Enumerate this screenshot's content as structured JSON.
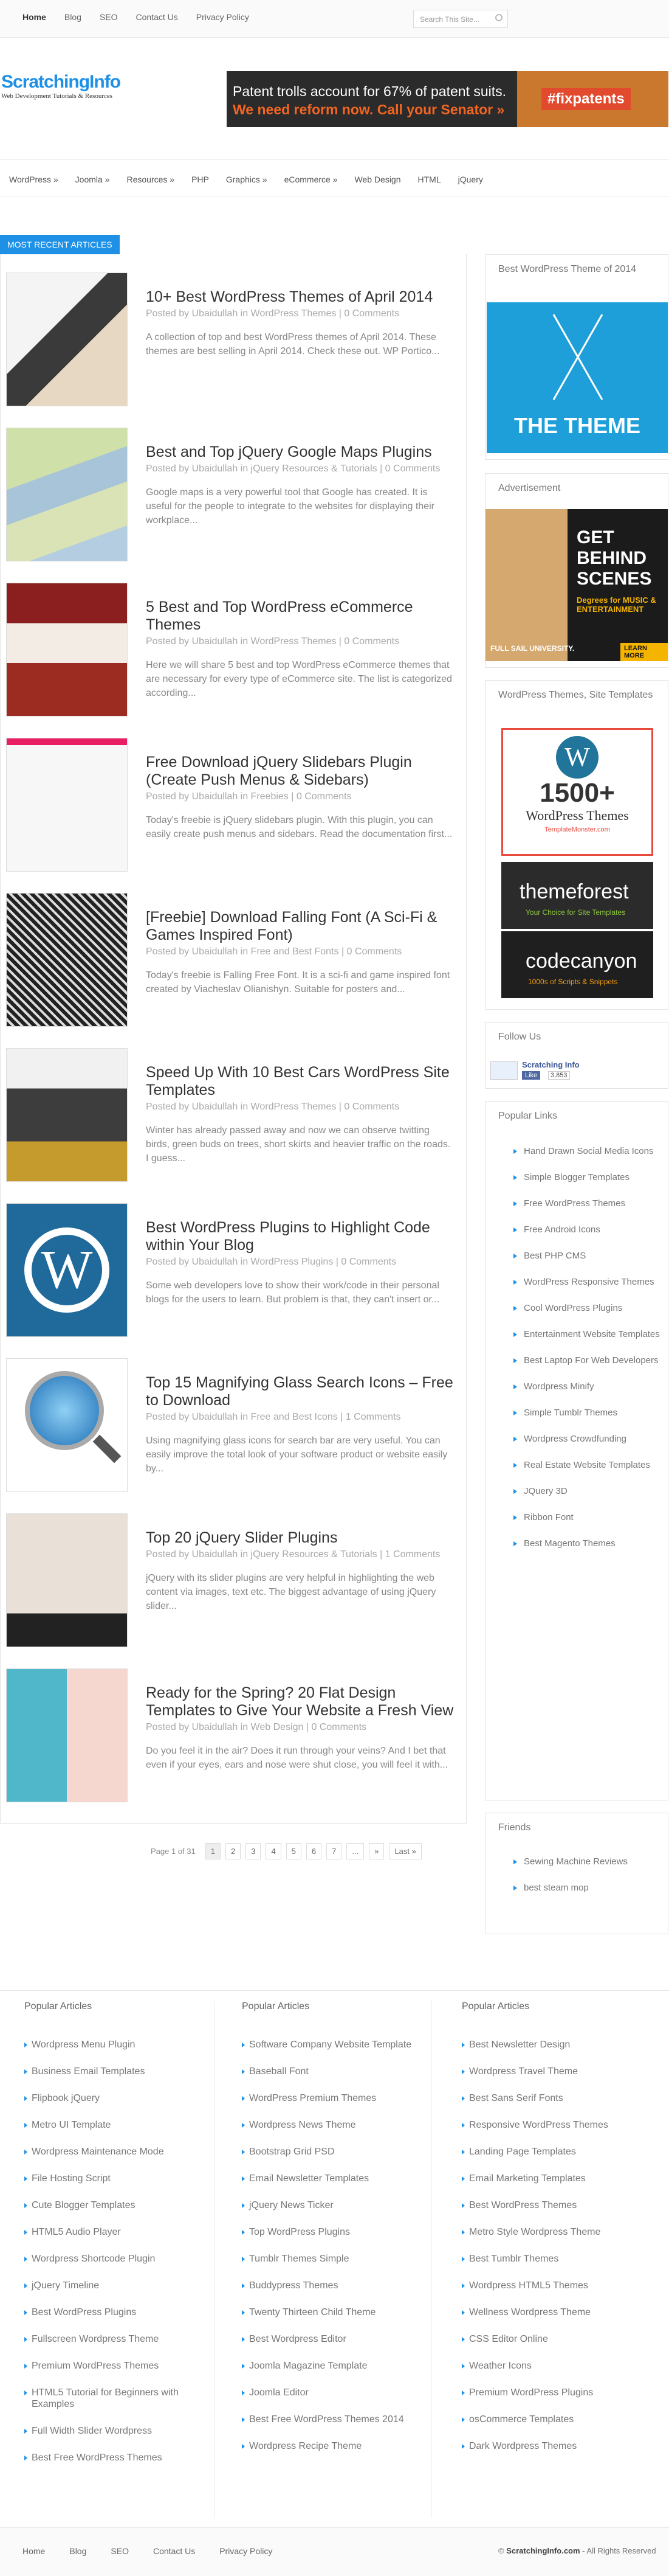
{
  "topnav": {
    "items": [
      "Home",
      "Blog",
      "SEO",
      "Contact Us",
      "Privacy Policy"
    ]
  },
  "search": {
    "placeholder": "Search This Site..."
  },
  "logo": {
    "title": "ScratchingInfo",
    "subtitle": "Web Development Tutorials & Resources"
  },
  "banner": {
    "line1": "Patent trolls account for 67% of patent suits.",
    "line2": "We need reform now. Call your Senator »",
    "tag": "#fixpatents"
  },
  "mainnav": {
    "items": [
      "WordPress »",
      "Joomla »",
      "Resources »",
      "PHP",
      "Graphics »",
      "eCommerce »",
      "Web Design",
      "HTML",
      "jQuery"
    ]
  },
  "section_label": "MOST RECENT ARTICLES",
  "articles": [
    {
      "title": "10+ Best WordPress Themes of April 2014",
      "meta": "Posted by Ubaidullah in WordPress Themes | 0 Comments",
      "excerpt": "A collection of top and best WordPress themes of April 2014. These themes are best selling in April 2014. Check these out. WP Portico..."
    },
    {
      "title": "Best and Top jQuery Google Maps Plugins",
      "meta": "Posted by Ubaidullah in jQuery Resources & Tutorials | 0 Comments",
      "excerpt": "Google maps is a very powerful tool that Google has created. It is useful for the people to integrate to the websites for displaying their workplace..."
    },
    {
      "title": "5 Best and Top WordPress eCommerce Themes",
      "meta": "Posted by Ubaidullah in WordPress Themes | 0 Comments",
      "excerpt": "Here we will share 5 best and top WordPress eCommerce themes that are necessary for every type of eCommerce site. The list is categorized according..."
    },
    {
      "title": "Free Download jQuery Slidebars Plugin (Create Push Menus & Sidebars)",
      "meta": "Posted by Ubaidullah in Freebies | 0 Comments",
      "excerpt": "Today's freebie is jQuery slidebars plugin. With this plugin, you can easily create push menus and sidebars. Read the documentation first..."
    },
    {
      "title": "[Freebie] Download Falling Font (A Sci-Fi & Games Inspired Font)",
      "meta": "Posted by Ubaidullah in Free and Best Fonts | 0 Comments",
      "excerpt": "Today's freebie is Falling Free Font. It is a sci-fi and game inspired font created by Viacheslav Olianishyn. Suitable for posters and..."
    },
    {
      "title": "Speed Up With 10 Best Cars WordPress Site Templates",
      "meta": "Posted by Ubaidullah in WordPress Themes | 0 Comments",
      "excerpt": "Winter has already passed away and now we can observe twitting birds, green buds on trees, short skirts and heavier traffic on the roads. I guess..."
    },
    {
      "title": "Best WordPress Plugins to Highlight Code within Your Blog",
      "meta": "Posted by Ubaidullah in WordPress Plugins | 0 Comments",
      "excerpt": "Some web developers love to show their work/code in their personal blogs for the users to learn. But problem is that, they can't insert or..."
    },
    {
      "title": "Top 15 Magnifying Glass Search Icons – Free to Download",
      "meta": "Posted by Ubaidullah in Free and Best Icons | 1 Comments",
      "excerpt": "Using magnifying glass icons for search bar are very useful. You can easily improve the total look of your software product or website easily by..."
    },
    {
      "title": "Top 20 jQuery Slider Plugins",
      "meta": "Posted by Ubaidullah in jQuery Resources & Tutorials | 1 Comments",
      "excerpt": "jQuery with its slider plugins are very helpful in highlighting the web content via images, text etc. The biggest advantage of using jQuery slider..."
    },
    {
      "title": "Ready for the Spring? 20 Flat Design Templates to Give Your Website a Fresh View",
      "meta": "Posted by Ubaidullah in Web Design | 0 Comments",
      "excerpt": "Do you feel it in the air? Does it run through your veins? And I bet that even if your eyes, ears and nose were shut close, you will feel it with..."
    }
  ],
  "pager": {
    "info": "Page 1 of 31",
    "pages": [
      "1",
      "2",
      "3",
      "4",
      "5",
      "6",
      "7",
      "...",
      "»",
      "Last »"
    ]
  },
  "sidebar": {
    "theme_widget": {
      "title": "Best WordPress Theme of 2014",
      "ad_text": "THE THEME"
    },
    "ad_widget": {
      "title": "Advertisement",
      "line1": "GET",
      "line2": "BEHIND",
      "line3": "SCENES",
      "line4": "Degrees for MUSIC & ENTERTAINMENT",
      "line5": "FULL SAIL UNIVERSITY.",
      "cta": "LEARN MORE"
    },
    "templates_widget": {
      "title": "WordPress Themes, Site Templates",
      "count": "1500+",
      "wp": "WordPress Themes",
      "tm": "TemplateMonster.com",
      "tf": "themeforest",
      "tf_sub": "Your Choice for Site Templates",
      "cc": "codecanyon",
      "cc_sub": "1000s of Scripts & Snippets"
    },
    "follow": {
      "title": "Follow Us",
      "name": "Scratching Info",
      "like": "Like",
      "count": "3,853"
    },
    "popular_links": {
      "title": "Popular Links",
      "items": [
        "Hand Drawn Social Media Icons",
        "Simple Blogger Templates",
        "Free WordPress Themes",
        "Free Android Icons",
        "Best PHP CMS",
        "WordPress Responsive Themes",
        "Cool WordPress Plugins",
        "Entertainment Website Templates",
        "Best Laptop For Web Developers",
        "Wordpress Minify",
        "Simple Tumblr Themes",
        "Wordpress Crowdfunding",
        "Real Estate Website Templates",
        "JQuery 3D",
        "Ribbon Font",
        "Best Magento Themes"
      ]
    },
    "friends": {
      "title": "Friends",
      "items": [
        "Sewing Machine Reviews",
        "best steam mop"
      ]
    }
  },
  "footer": {
    "columns": [
      {
        "title": "Popular Articles",
        "items": [
          "Wordpress Menu Plugin",
          "Business Email Templates",
          "Flipbook jQuery",
          "Metro UI Template",
          "Wordpress Maintenance Mode",
          "File Hosting Script",
          "Cute Blogger Templates",
          "HTML5 Audio Player",
          "Wordpress Shortcode Plugin",
          "jQuery Timeline",
          "Best WordPress Plugins",
          "Fullscreen Wordpress Theme",
          "Premium WordPress Themes",
          "HTML5 Tutorial for Beginners with Examples",
          "Full Width Slider Wordpress",
          "Best Free WordPress Themes"
        ]
      },
      {
        "title": "Popular Articles",
        "items": [
          "Software Company Website Template",
          "Baseball Font",
          "WordPress Premium Themes",
          "Wordpress News Theme",
          "Bootstrap Grid PSD",
          "Email Newsletter Templates",
          "jQuery News Ticker",
          "Top WordPress Plugins",
          "Tumblr Themes Simple",
          "Buddypress Themes",
          "Twenty Thirteen Child Theme",
          "Best Wordpress Editor",
          "Joomla Magazine Template",
          "Joomla Editor",
          "Best Free WordPress Themes 2014",
          "Wordpress Recipe Theme"
        ]
      },
      {
        "title": "Popular Articles",
        "items": [
          "Best Newsletter Design",
          "Wordpress Travel Theme",
          "Best Sans Serif Fonts",
          "Responsive WordPress Themes",
          "Landing Page Templates",
          "Email Marketing Templates",
          "Best WordPress Themes",
          "Metro Style Wordpress Theme",
          "Best Tumblr Themes",
          "Wordpress HTML5 Themes",
          "Wellness Wordpress Theme",
          "CSS Editor Online",
          "Weather Icons",
          "Premium WordPress Plugins",
          "osCommerce Templates",
          "Dark Wordpress Themes"
        ]
      }
    ]
  },
  "bottom": {
    "nav": [
      "Home",
      "Blog",
      "SEO",
      "Contact Us",
      "Privacy Policy"
    ],
    "copy_pre": "© ",
    "copy_site": "ScratchingInfo.com",
    "copy_post": " - All Rights Reserved"
  },
  "colors": {
    "accent": "#1e90e6",
    "patent_orange": "#f26522",
    "theme_blue": "#1e9fd9"
  }
}
